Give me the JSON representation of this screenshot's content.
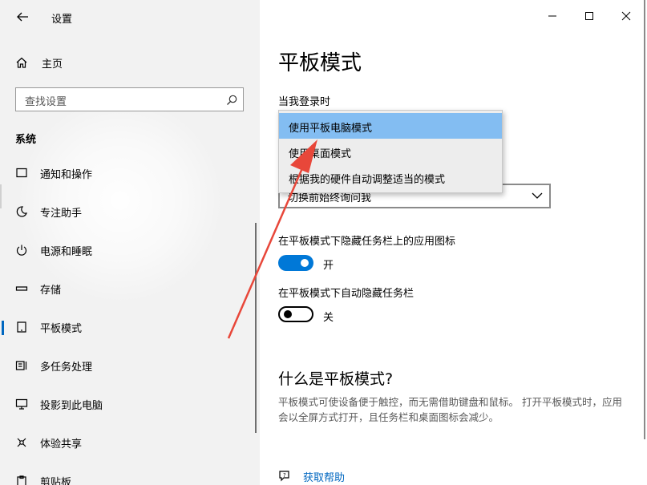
{
  "window": {
    "title": "设置",
    "controls": [
      "minimize",
      "maximize",
      "close"
    ]
  },
  "sidebar": {
    "home_label": "主页",
    "search": {
      "placeholder": "查找设置"
    },
    "section_title": "系统",
    "items": [
      {
        "label": "通知和操作",
        "icon": "notification-icon"
      },
      {
        "label": "专注助手",
        "icon": "moon-icon"
      },
      {
        "label": "电源和睡眠",
        "icon": "power-icon"
      },
      {
        "label": "存储",
        "icon": "storage-icon"
      },
      {
        "label": "平板模式",
        "icon": "tablet-icon",
        "active": true
      },
      {
        "label": "多任务处理",
        "icon": "multitask-icon"
      },
      {
        "label": "投影到此电脑",
        "icon": "project-icon"
      },
      {
        "label": "体验共享",
        "icon": "share-icon"
      },
      {
        "label": "剪贴板",
        "icon": "clipboard-icon"
      }
    ]
  },
  "main": {
    "title": "平板模式",
    "signin_label": "当我登录时",
    "dropdown_options": [
      "使用平板电脑模式",
      "使用桌面模式",
      "根据我的硬件自动调整适当的模式"
    ],
    "dropdown_selected": "使用平板电脑模式",
    "combo_value_partial": "切换前始终询问我",
    "hide_icons_label": "在平板模式下隐藏任务栏上的应用图标",
    "hide_icons_state": "开",
    "autohide_label": "在平板模式下自动隐藏任务栏",
    "autohide_state": "关",
    "what_is_title": "什么是平板模式?",
    "what_is_text": "平板模式可使设备便于触控，而无需借助键盘和鼠标。 打开平板模式时，应用会以全屏方式打开，且任务栏和桌面图标会减少。",
    "help_link": "获取帮助"
  },
  "colors": {
    "accent": "#0078d7",
    "selected_option": "#83bdf2",
    "annotation_arrow": "#e8473a"
  }
}
